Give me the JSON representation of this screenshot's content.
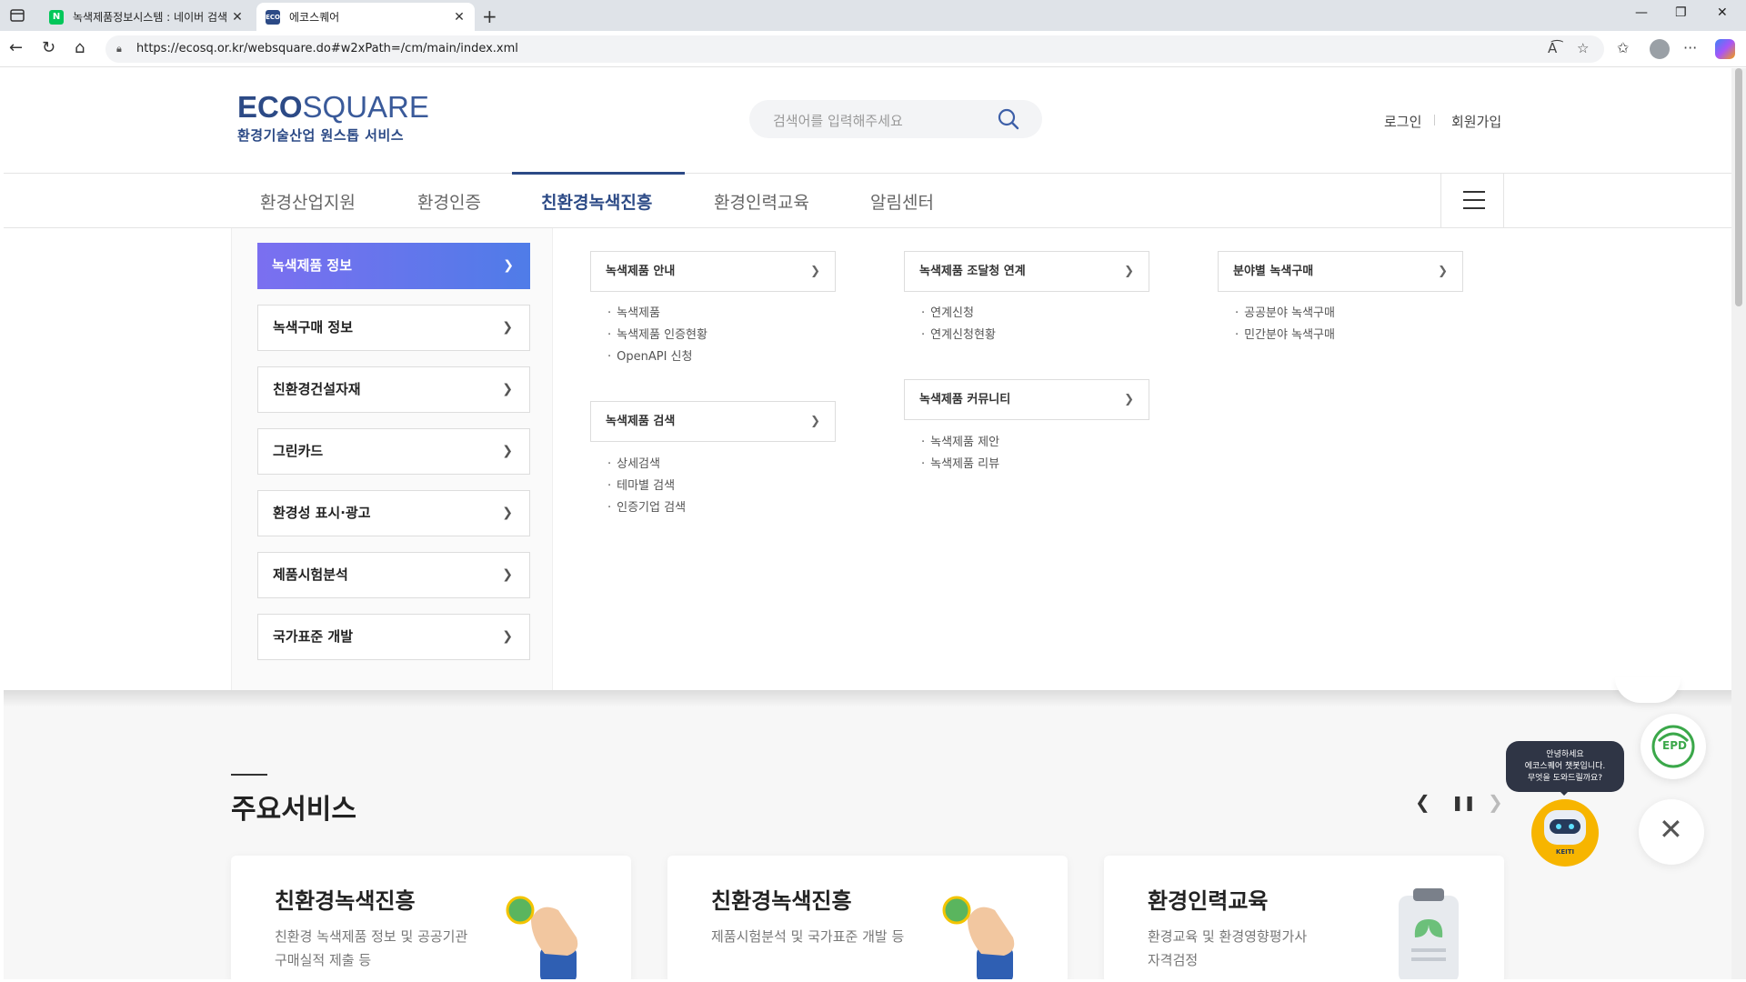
{
  "browser": {
    "tabs": [
      {
        "label": "녹색제품정보시스템 : 네이버 검색",
        "favicon": "naver-icon",
        "favicon_text": "N",
        "active": false
      },
      {
        "label": "에코스퀘어",
        "favicon": "ecosquare-icon",
        "favicon_text": "ECO",
        "active": true
      }
    ],
    "url": "https://ecosq.or.kr/websquare.do#w2xPath=/cm/main/index.xml"
  },
  "header": {
    "logo_bold": "ECO",
    "logo_light": "SQUARE",
    "logo_sub": "환경기술산업 원스톱 서비스",
    "search_placeholder": "검색어를 입력해주세요",
    "login": "로그인",
    "signup": "회원가입"
  },
  "gnb": {
    "items": [
      "환경산업지원",
      "환경인증",
      "친환경녹색진흥",
      "환경인력교육",
      "알림센터"
    ],
    "active_index": 2
  },
  "mega_menu": {
    "left": [
      "녹색제품 정보",
      "녹색구매 정보",
      "친환경건설자재",
      "그린카드",
      "환경성 표시·광고",
      "제품시험분석",
      "국가표준 개발"
    ],
    "active_left_index": 0,
    "groups": [
      {
        "title": "녹색제품 안내",
        "items": [
          "녹색제품",
          "녹색제품 인증현황",
          "OpenAPI 신청"
        ]
      },
      {
        "title": "녹색제품 검색",
        "items": [
          "상세검색",
          "테마별 검색",
          "인증기업 검색"
        ]
      },
      {
        "title": "녹색제품 조달청 연계",
        "items": [
          "연계신청",
          "연계신청현황"
        ]
      },
      {
        "title": "녹색제품 커뮤니티",
        "items": [
          "녹색제품 제안",
          "녹색제품 리뷰"
        ]
      },
      {
        "title": "분야별 녹색구매",
        "items": [
          "공공분야 녹색구매",
          "민간분야 녹색구매"
        ]
      }
    ]
  },
  "main_services": {
    "title": "주요서비스",
    "cards": [
      {
        "title": "친환경녹색진흥",
        "desc_1": "친환경 녹색제품 정보 및 공공기관",
        "desc_2": "구매실적 제출 등"
      },
      {
        "title": "친환경녹색진흥",
        "desc_1": "제품시험분석 및 국가표준 개발 등",
        "desc_2": ""
      },
      {
        "title": "환경인력교육",
        "desc_1": "환경교육 및 환경영향평가사",
        "desc_2": "자격검정"
      }
    ]
  },
  "widgets": {
    "chat_bubble_1": "안녕하세요",
    "chat_bubble_2": "에코스퀘어 챗봇입니다.",
    "chat_bubble_3": "무엇을 도와드릴까요?",
    "chatbot_label": "KEITI",
    "epd_label": "EPD"
  },
  "colors": {
    "brand": "#2c4a86",
    "active_gradient_start": "#7b6ff0",
    "active_gradient_end": "#4f7ce8",
    "chatbot": "#f7b500"
  }
}
